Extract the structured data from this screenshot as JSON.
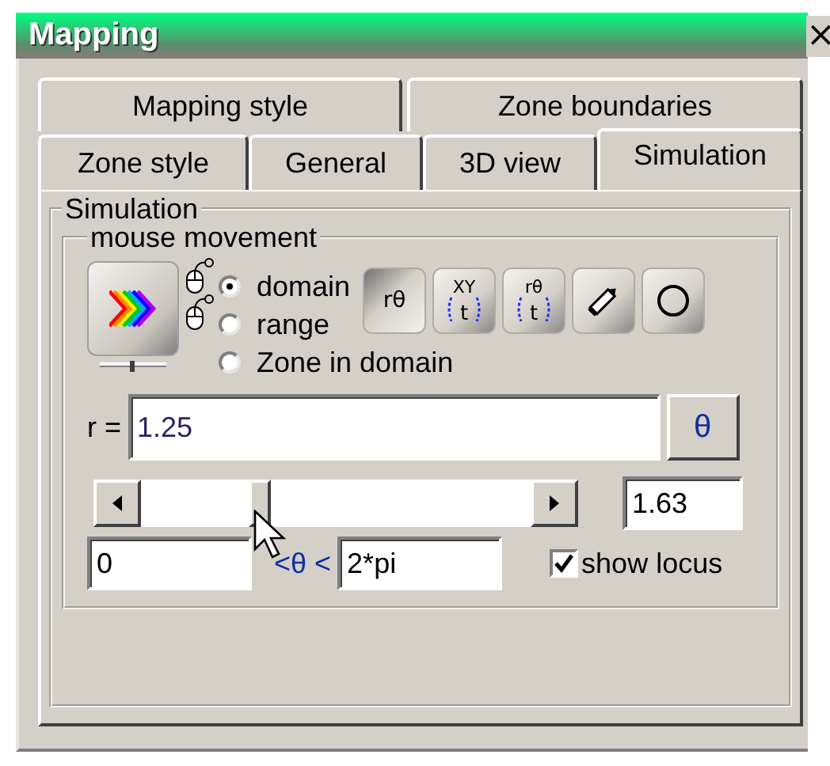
{
  "window": {
    "title": "Mapping",
    "close": "×"
  },
  "tab_rows": [
    {
      "tabs": [
        {
          "label": "Mapping style",
          "selected": false
        },
        {
          "label": "Zone boundaries",
          "selected": false
        }
      ]
    },
    {
      "tabs": [
        {
          "label": "Zone style",
          "selected": false
        },
        {
          "label": "General",
          "selected": false
        },
        {
          "label": "3D view",
          "selected": false
        },
        {
          "label": "Simulation",
          "selected": true
        }
      ]
    }
  ],
  "simulation": {
    "title": "Simulation",
    "mouse_movement": {
      "title": "mouse movement",
      "modes": [
        {
          "label": "domain",
          "selected": true
        },
        {
          "label": "range",
          "selected": false
        },
        {
          "label": "Zone in domain",
          "selected": false
        }
      ],
      "tool_buttons": [
        {
          "kind": "text",
          "label": "rθ",
          "selected": true
        },
        {
          "kind": "param",
          "top": "XY",
          "bottom": "t",
          "selected": false
        },
        {
          "kind": "param",
          "top": "rθ",
          "bottom": "t",
          "selected": false
        },
        {
          "kind": "pencil",
          "selected": false
        },
        {
          "kind": "circle",
          "selected": false
        }
      ],
      "r_label": "r =",
      "r_value": "1.25",
      "theta_button": "θ",
      "slider_value": "1.63",
      "range": {
        "min": "0",
        "separator": "<θ <",
        "max": "2*pi"
      },
      "show_locus": {
        "label": "show locus",
        "checked": true
      }
    }
  }
}
